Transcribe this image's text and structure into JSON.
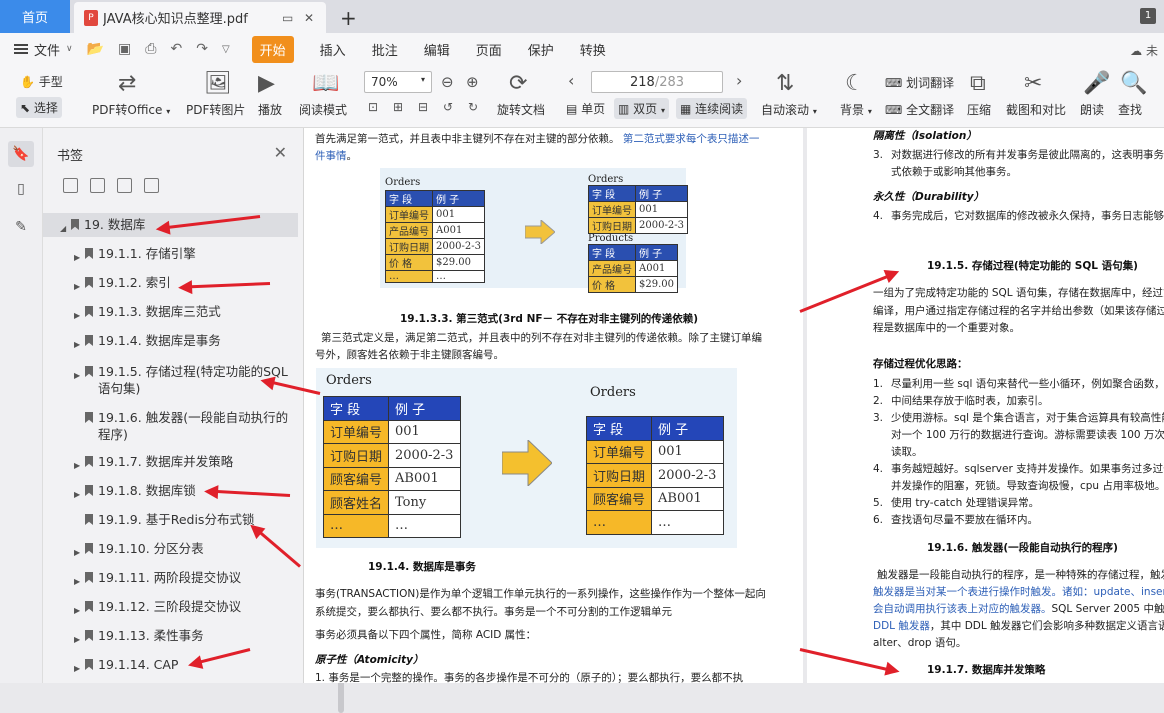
{
  "tabs": {
    "home": "首页",
    "doc": "JAVA核心知识点整理.pdf",
    "win_count": "1"
  },
  "menu": {
    "file": "文件",
    "items": [
      "开始",
      "插入",
      "批注",
      "编辑",
      "页面",
      "保护",
      "转换"
    ],
    "active": "开始",
    "cloud": "未"
  },
  "toolbar": {
    "hand": "手型",
    "select": "选择",
    "pdf_office": "PDF转Office",
    "pdf_img": "PDF转图片",
    "play": "播放",
    "read_mode": "阅读模式",
    "zoom": "70%",
    "page_current": "218",
    "page_total": "/283",
    "rotate": "旋转文档",
    "single": "单页",
    "double": "双页",
    "continuous": "连续阅读",
    "auto_scroll": "自动滚动",
    "background": "背景",
    "word_translate": "划词翻译",
    "full_translate": "全文翻译",
    "compress": "压缩",
    "screenshot": "截图和对比",
    "read_aloud": "朗读",
    "find": "查找"
  },
  "sidebar": {
    "title": "书签",
    "items": [
      {
        "label": "19. 数据库",
        "level": 0,
        "expand": "▲",
        "selected": true
      },
      {
        "label": "19.1.1. 存储引擎",
        "level": 1,
        "expand": "▶"
      },
      {
        "label": "19.1.2. 索引",
        "level": 1,
        "expand": "▶"
      },
      {
        "label": "19.1.3. 数据库三范式",
        "level": 1,
        "expand": "▶"
      },
      {
        "label": "19.1.4. 数据库是事务",
        "level": 1,
        "expand": "▶"
      },
      {
        "label": "19.1.5. 存储过程(特定功能的SQL",
        "label2": "语句集)",
        "level": 1,
        "expand": "▶"
      },
      {
        "label": "19.1.6. 触发器(一段能自动执行的",
        "label2": "程序)",
        "level": 1,
        "expand": ""
      },
      {
        "label": "19.1.7. 数据库并发策略",
        "level": 1,
        "expand": "▶"
      },
      {
        "label": "19.1.8. 数据库锁",
        "level": 1,
        "expand": "▶"
      },
      {
        "label": "19.1.9. 基于Redis分布式锁",
        "level": 1,
        "expand": ""
      },
      {
        "label": "19.1.10. 分区分表",
        "level": 1,
        "expand": "▶"
      },
      {
        "label": "19.1.11. 两阶段提交协议",
        "level": 1,
        "expand": "▶"
      },
      {
        "label": "19.1.12. 三阶段提交协议",
        "level": 1,
        "expand": "▶"
      },
      {
        "label": "19.1.13. 柔性事务",
        "level": 1,
        "expand": "▶"
      },
      {
        "label": "19.1.14. CAP",
        "level": 1,
        "expand": "▶"
      }
    ]
  },
  "left_page": {
    "intro": "首先满足第一范式，并且表中非主键列不存在对主键的部分依赖。",
    "intro_blue": "第二范式要求每个表只描述一",
    "intro_blue2": "件事情",
    "intro_end": "。",
    "small_fig": {
      "orders": "Orders",
      "products": "Products",
      "h1": "字  段",
      "h2": "例  子",
      "rows": [
        [
          "订单编号",
          "001"
        ],
        [
          "产品编号",
          "A001"
        ],
        [
          "订购日期",
          "2000-2-3"
        ],
        [
          "价  格",
          "$29.00"
        ],
        [
          "…",
          "…"
        ]
      ],
      "r1": [
        [
          "订单编号",
          "001"
        ],
        [
          "订购日期",
          "2000-2-3"
        ]
      ],
      "r2": [
        [
          "产品编号",
          "A001"
        ],
        [
          "价  格",
          "$29.00"
        ]
      ]
    },
    "h_3nf": "19.1.3.3.    第三范式(3rd NF－ 不存在对非主键列的传递依赖)",
    "p_3nf_1": "第三范式定义是，满足第二范式，并且表中的列不存在对非主键列的传递依赖。除了主键订单编",
    "p_3nf_2": "号外，顾客姓名依赖于非主键顾客编号。",
    "big_fig": {
      "orders": "Orders",
      "h1": "字  段",
      "h2": "例  子",
      "rows": [
        [
          "订单编号",
          "001"
        ],
        [
          "订购日期",
          "2000-2-3"
        ],
        [
          "顾客编号",
          "AB001"
        ],
        [
          "顾客姓名",
          "Tony"
        ],
        [
          "…",
          "…"
        ]
      ],
      "r2": [
        [
          "订单编号",
          "001"
        ],
        [
          "订购日期",
          "2000-2-3"
        ],
        [
          "顾客编号",
          "AB001"
        ],
        [
          "…",
          "…"
        ]
      ]
    },
    "h_tx": "19.1.4.     数据库是事务",
    "p_tx1": "事务(TRANSACTION)是作为单个逻辑工作单元执行的一系列操作，这些操作作为一个整体一起向",
    "p_tx2": "系统提交，要么都执行、要么都不执行。事务是一个不可分割的工作逻辑单元",
    "p_tx3": "事务必须具备以下四个属性，简称 ACID 属性：",
    "atomicity": "原子性（Atomicity）",
    "atom1": "1.   事务是一个完整的操作。事务的各步操作是不可分的（原子的）；要么都执行，要么都不执"
  },
  "right_page": {
    "isolation": "隔离性（Isolation）",
    "iso3a": "对数据进行修改的所有并发事务是彼此隔离的，这表明事务必",
    "iso3b": "式依赖于或影响其他事务。",
    "durability": "永久性（Durability）",
    "dur4": "事务完成后，它对数据库的修改被永久保持，事务日志能够保持",
    "h_sp": "19.1.5.      存储过程(特定功能的 SQL 语句集)",
    "sp1": "一组为了完成特定功能的 SQL 语句集，存储在数据库中，经过第一",
    "sp2": "编译，用户通过指定存储过程的名字并给出参数（如果该存储过程",
    "sp3": "程是数据库中的一个重要对象。",
    "opt_title": "存储过程优化思路：",
    "opt": [
      [
        "1.",
        "尽量利用一些 sql 语句来替代一些小循环，例如聚合函数，求平"
      ],
      [
        "2.",
        "中间结果存放于临时表，加索引。"
      ],
      [
        "3.",
        "少使用游标。sql 是个集合语言，对于集合运算具有较高性能。"
      ],
      [
        "",
        "对一个 100 万行的数据进行查询。游标需要读表 100 万次，而"
      ],
      [
        "",
        "读取。"
      ],
      [
        "4.",
        "事务越短越好。sqlserver 支持并发操作。如果事务过多过长，"
      ],
      [
        "",
        "并发操作的阻塞，死锁。导致查询极慢，cpu 占用率极地。"
      ],
      [
        "5.",
        "使用 try-catch 处理错误异常。"
      ],
      [
        "6.",
        "查找语句尽量不要放在循环内。"
      ]
    ],
    "h_trig": "19.1.6.      触发器(一段能自动执行的程序)",
    "tr1": "触发器是一段能自动执行的程序，是一种特殊的存储过程，触发器",
    "tr2": "触发器是当对某一个表进行操作时触发。诸如：update、insert、d",
    "tr3a": "会自动调用执行该表上对应的触发器。",
    "tr3b": "SQL Server 2005 中触发器可",
    "tr4a": "DDL 触发器",
    "tr4b": "，其中 DDL 触发器它们会影响多种数据定义语言语句",
    "tr5": "alter、drop 语句。",
    "h_conc": "19.1.7.      数据库并发策略"
  },
  "colors": {
    "accent": "#3b8bea",
    "start_tab": "#f18f1c",
    "arrow": "#e0202a",
    "table_head": "#2446b8",
    "table_key": "#f6b828"
  }
}
